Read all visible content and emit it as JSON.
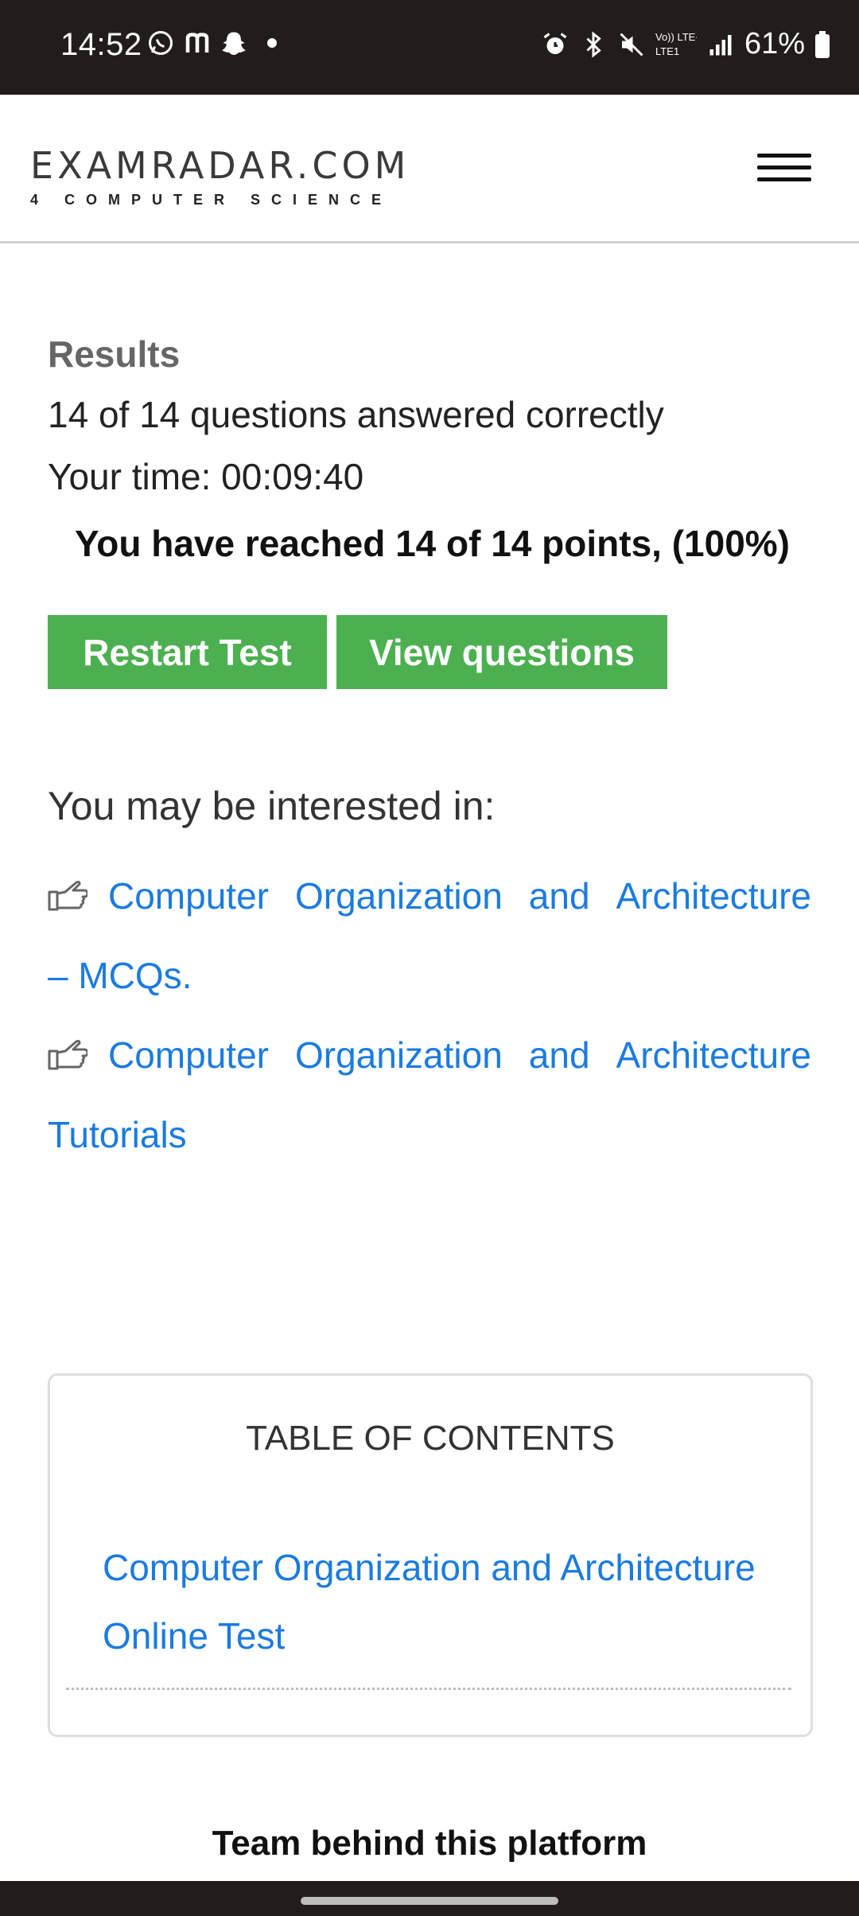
{
  "status_bar": {
    "time": "14:52",
    "battery": "61%",
    "left_icons": [
      "whatsapp-icon",
      "m-app-icon",
      "snapchat-icon",
      "dot-icon"
    ],
    "right_icons": [
      "alarm-icon",
      "bluetooth-icon",
      "mute-icon",
      "volte-lte-icon",
      "signal-icon",
      "battery-icon"
    ],
    "network_label_top": "Vo)) LTE+",
    "network_label_bottom": "LTE1"
  },
  "header": {
    "logo_title": "EXAMRADAR.COM",
    "logo_subtitle": "4 COMPUTER SCIENCE"
  },
  "results": {
    "label": "Results",
    "answered": "14 of 14 questions answered correctly",
    "time": "Your time: 00:09:40",
    "points": "You have reached 14 of 14 points, (100%)"
  },
  "buttons": {
    "restart": "Restart Test",
    "view": "View questions"
  },
  "interested": {
    "title": "You may be interested in:",
    "links": [
      {
        "row1": [
          "Computer",
          "Organization",
          "and",
          "Architecture"
        ],
        "row2": "– MCQs."
      },
      {
        "row1": [
          "Computer",
          "Organization",
          "and",
          "Architecture"
        ],
        "row2": "Tutorials"
      }
    ]
  },
  "toc": {
    "title": "TABLE OF CONTENTS",
    "link_line1": "Computer Organization and Architecture",
    "link_line2": "Online Test"
  },
  "footer": {
    "team_title": "Team behind this platform"
  },
  "colors": {
    "button_green": "#4cb050",
    "link_blue": "#1b7be0",
    "status_bar_bg": "#221d1a"
  }
}
